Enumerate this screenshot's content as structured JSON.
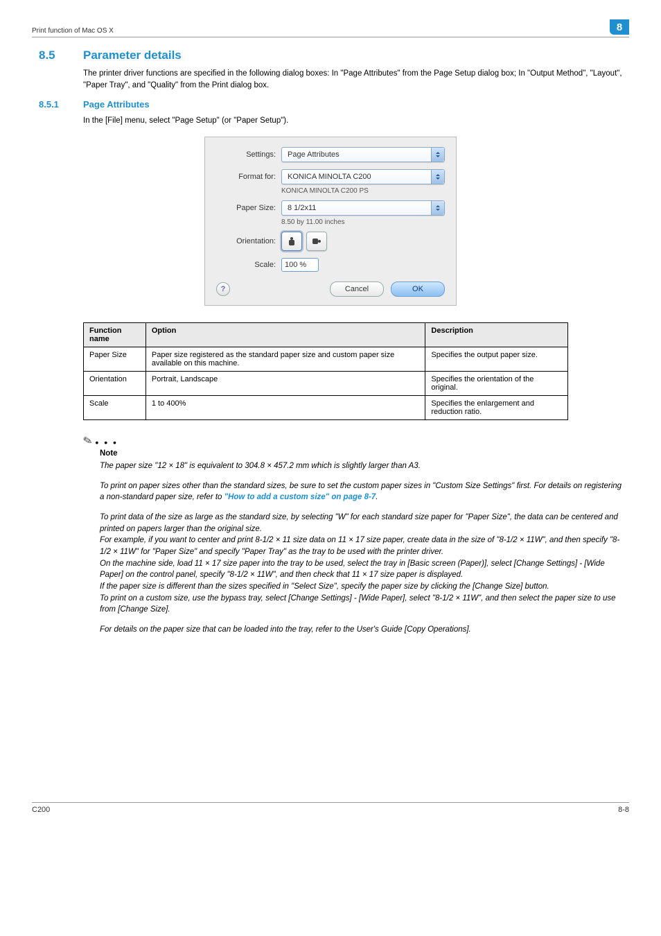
{
  "header": {
    "left": "Print function of Mac OS X",
    "badge": "8"
  },
  "section": {
    "num": "8.5",
    "title": "Parameter details",
    "intro": "The printer driver functions are specified in the following dialog boxes: In \"Page Attributes\" from the Page Setup dialog box; In \"Output Method\", \"Layout\", \"Paper Tray\", and \"Quality\" from the Print dialog box."
  },
  "subsection": {
    "num": "8.5.1",
    "title": "Page Attributes",
    "intro": "In the [File] menu, select \"Page Setup\" (or \"Paper Setup\")."
  },
  "dialog": {
    "settings_lbl": "Settings:",
    "settings_val": "Page Attributes",
    "format_lbl": "Format for:",
    "format_val": "KONICA MINOLTA C200",
    "format_sub": "KONICA MINOLTA C200 PS",
    "paper_lbl": "Paper Size:",
    "paper_val": "8 1/2x11",
    "paper_sub": "8.50 by 11.00 inches",
    "orient_lbl": "Orientation:",
    "scale_lbl": "Scale:",
    "scale_val": "100 %",
    "help": "?",
    "cancel": "Cancel",
    "ok": "OK"
  },
  "table": {
    "h1": "Function name",
    "h2": "Option",
    "h3": "Description",
    "r1c1": "Paper Size",
    "r1c2": "Paper size registered as the standard paper size and custom paper size available on this machine.",
    "r1c3": "Specifies the output paper size.",
    "r2c1": "Orientation",
    "r2c2": "Portrait, Landscape",
    "r2c3": "Specifies the orientation of the original.",
    "r3c1": "Scale",
    "r3c2": "1 to 400%",
    "r3c3": "Specifies the enlargement and reduction ratio."
  },
  "note": {
    "label": "Note",
    "p1": "The paper size \"12 × 18\" is equivalent to 304.8 × 457.2 mm which is slightly larger than A3.",
    "p2a": "To print on paper sizes other than the standard sizes, be sure to set the custom paper sizes in \"Custom Size Settings\" first. For details on registering a non-standard paper size, refer to ",
    "p2link": "\"How to add a custom size\" on page 8-7",
    "p2b": ".",
    "p3": "To print data of the size as large as the standard size, by selecting \"W\" for each standard size paper for \"Paper Size\", the data can be centered and printed on papers larger than the original size.\nFor example, if you want to center and print 8-1/2 × 11 size data on 11 × 17 size paper, create data in the size of \"8-1/2 × 11W\", and then specify \"8-1/2 × 11W\" for \"Paper Size\" and specify \"Paper Tray\" as the tray to be used with the printer driver.\nOn the machine side, load 11 × 17 size paper into the tray to be used, select the tray in [Basic screen (Paper)], select [Change Settings] - [Wide Paper] on the control panel, specify \"8-1/2 × 11W\", and then check that 11 × 17 size paper is displayed.\nIf the paper size is different than the sizes specified in \"Select Size\", specify the paper size by clicking the [Change Size] button.\nTo print on a custom size, use the bypass tray, select [Change Settings] - [Wide Paper], select \"8-1/2 × 11W\", and then select the paper size to use from [Change Size].",
    "p4": "For details on the paper size that can be loaded into the tray, refer to the User's Guide [Copy Operations]."
  },
  "footer": {
    "left": "C200",
    "right": "8-8"
  }
}
